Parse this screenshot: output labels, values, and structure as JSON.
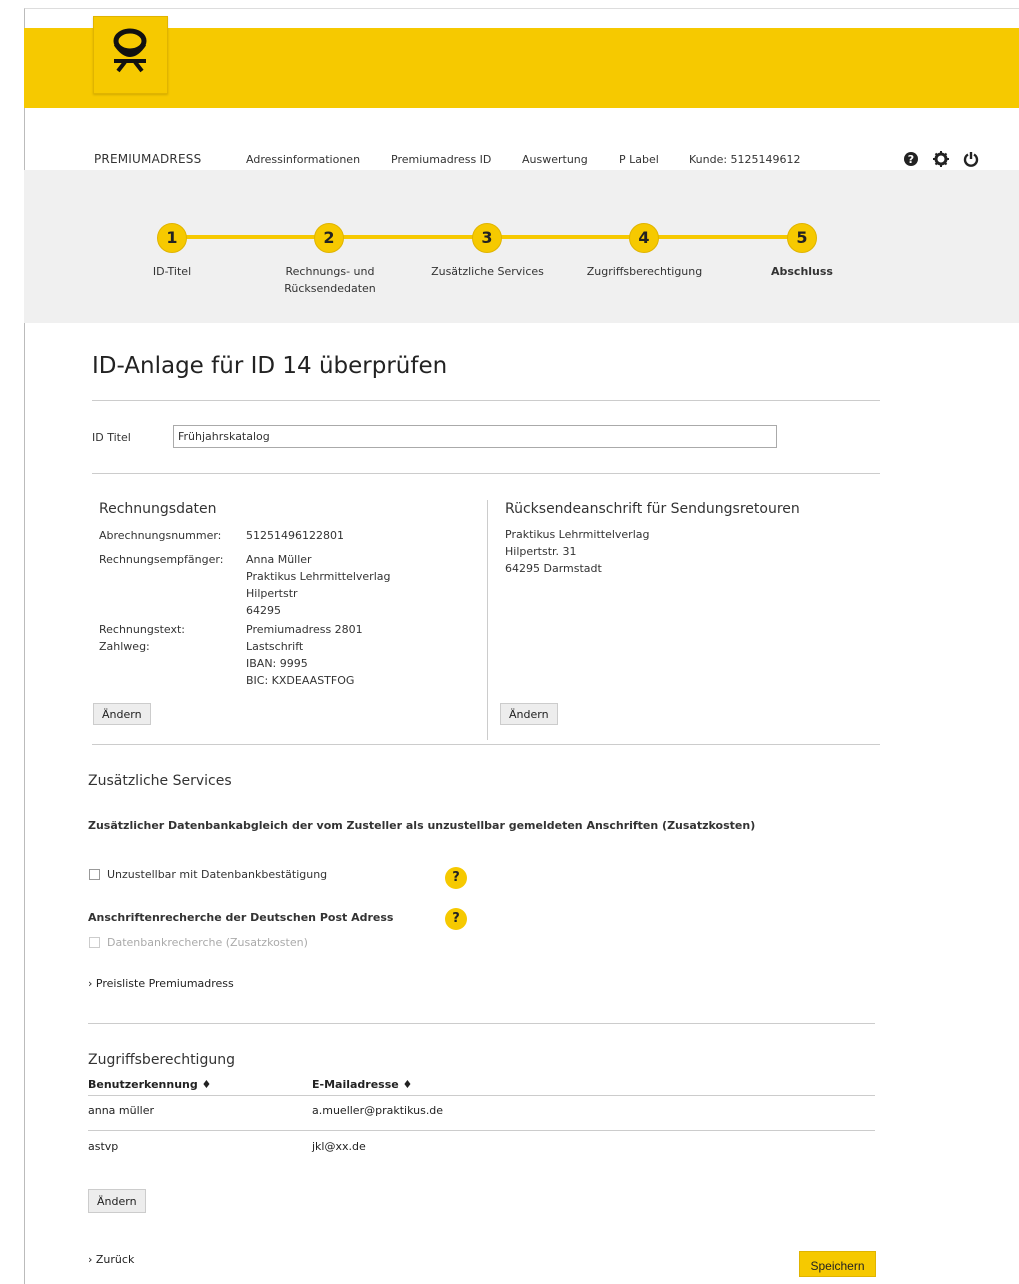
{
  "nav": {
    "brand": "PREMIUMADRESS",
    "items": [
      "Adressinformationen",
      "Premiumadress ID",
      "Auswertung",
      "P Label",
      "Kunde: 5125149612"
    ]
  },
  "steps": [
    {
      "number": "1",
      "label": "ID-Titel"
    },
    {
      "number": "2",
      "label": "Rechnungs- und\nRücksendedaten"
    },
    {
      "number": "3",
      "label": "Zusätzliche Services"
    },
    {
      "number": "4",
      "label": "Zugriffsberechtigung"
    },
    {
      "number": "5",
      "label": "Abschluss"
    }
  ],
  "page": {
    "title": "ID-Anlage für ID 14 überprüfen",
    "id_title_label": "ID Titel",
    "id_title_value": "Frühjahrskatalog"
  },
  "billing": {
    "title": "Rechnungsdaten",
    "rows": [
      {
        "label": "Abrechnungsnummer:",
        "value": "51251496122801"
      },
      {
        "label": "Rechnungsempfänger:",
        "value": "Anna Müller\nPraktikus Lehrmittelverlag\nHilpertstr\n64295"
      },
      {
        "label": "Rechnungstext:",
        "value": "Premiumadress 2801"
      },
      {
        "label": "Zahlweg:",
        "value": "Lastschrift\nIBAN: 9995\nBIC: KXDEAASTFOG"
      }
    ],
    "change_button": "Ändern"
  },
  "return_address": {
    "title": "Rücksendeanschrift für Sendungsretouren",
    "lines": [
      "Praktikus Lehrmittelverlag",
      "Hilpertstr. 31",
      "64295 Darmstadt"
    ],
    "change_button": "Ändern"
  },
  "services": {
    "title": "Zusätzliche Services",
    "subtitle": "Zusätzlicher Datenbankabgleich der vom Zusteller als unzustellbar gemeldeten Anschriften (Zusatzkosten)",
    "checkbox1": "Unzustellbar mit Datenbankbestätigung",
    "research_title": "Anschriftenrecherche der Deutschen Post Adress",
    "checkbox2": "Datenbankrecherche (Zusatzkosten)",
    "help": "?",
    "price_link": "› Preisliste Premiumadress"
  },
  "access": {
    "title": "Zugriffsberechtigung",
    "col1": "Benutzerkennung ♦",
    "col2": "E-Mailadresse ♦",
    "rows": [
      {
        "user": "anna müller",
        "email": "a.mueller@praktikus.de"
      },
      {
        "user": "astvp",
        "email": "jkl@xx.de"
      }
    ],
    "change_button": "Ändern"
  },
  "footer": {
    "back": "› Zurück",
    "save": "Speichern"
  },
  "colors": {
    "accent": "#f6c900"
  }
}
